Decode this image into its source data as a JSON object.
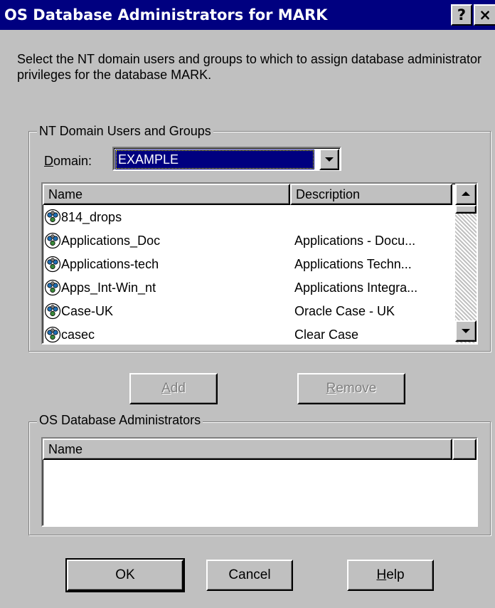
{
  "window": {
    "title": "OS Database Administrators for MARK",
    "help_btn": "?",
    "close_btn": "×"
  },
  "instructions": "Select the NT domain users and groups to which to assign database administrator privileges for the database MARK.",
  "domain_group": {
    "label": "NT Domain Users and Groups",
    "domain_label": "Domain:",
    "domain_value": "EXAMPLE",
    "columns": [
      "Name",
      "Description"
    ],
    "rows": [
      {
        "name": "814_drops",
        "description": ""
      },
      {
        "name": "Applications_Doc",
        "description": "Applications - Docu..."
      },
      {
        "name": "Applications-tech",
        "description": "Applications Techn..."
      },
      {
        "name": "Apps_Int-Win_nt",
        "description": "Applications Integra..."
      },
      {
        "name": "Case-UK",
        "description": "Oracle Case - UK"
      },
      {
        "name": "casec",
        "description": "Clear Case"
      }
    ]
  },
  "buttons": {
    "add": "Add",
    "remove": "Remove",
    "ok": "OK",
    "cancel": "Cancel",
    "help": "Help"
  },
  "admins_group": {
    "label": "OS Database Administrators",
    "columns": [
      "Name"
    ]
  },
  "colors": {
    "titlebar": "#000080",
    "face": "#c0c0c0",
    "highlight": "#000080"
  }
}
